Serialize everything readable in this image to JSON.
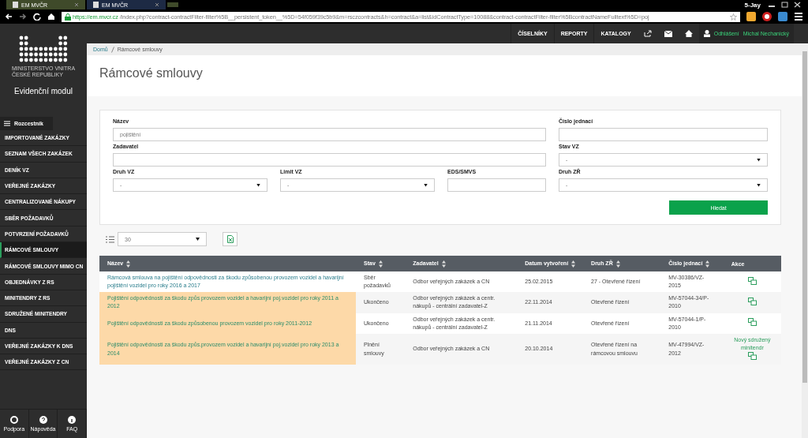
{
  "browser": {
    "tabs": [
      {
        "title": "EM MVČR",
        "selected": false
      },
      {
        "title": "EM MVČR",
        "selected": true
      }
    ],
    "user": "5-Jay",
    "url_host": "https://em.mvcr.cz",
    "url_path": "/index.php?contract-contractFilter-filter%5B__persistent_token__%5D=54f059f39c5b9&m=rsczcontracts&h=contract&a=list&idContractType=10088&contract-contractFilter-filter%5BcontractNameFulltext%5D=poj"
  },
  "header": {
    "menu": [
      "ČÍSELNÍKY",
      "REPORTY",
      "KATALOGY"
    ],
    "logout": "Odhlášení",
    "user_name": "Michal Nechanický"
  },
  "sidebar": {
    "logo_text": [
      "MINISTERSTVO VNITRA",
      "ČESKÉ REPUBLIKY"
    ],
    "app_name": "Evidenční modul",
    "menu_toggle": "Rozcestník",
    "items": [
      {
        "label": "IMPORTOVANÉ ZAKÁZKY",
        "selected": false
      },
      {
        "label": "SEZNAM VŠECH ZAKÁZEK",
        "selected": false
      },
      {
        "label": "DENÍK VZ",
        "selected": false
      },
      {
        "label": "VEŘEJNÉ ZAKÁZKY",
        "selected": false
      },
      {
        "label": "CENTRALIZOVANÉ NÁKUPY",
        "selected": false
      },
      {
        "label": "SBĚR POŽADAVKŮ",
        "selected": false
      },
      {
        "label": "POTVRZENÍ POŽADAVKŮ",
        "selected": false
      },
      {
        "label": "RÁMCOVÉ SMLOUVY",
        "selected": true
      },
      {
        "label": "RÁMCOVÉ SMLOUVY MIMO CN",
        "selected": false
      },
      {
        "label": "OBJEDNÁVKY Z RS",
        "selected": false
      },
      {
        "label": "MINITENDRY Z RS",
        "selected": false
      },
      {
        "label": "SDRUŽENÉ MINITENDRY",
        "selected": false
      },
      {
        "label": "DNS",
        "selected": false
      },
      {
        "label": "VEŘEJNÉ ZAKÁZKY K DNS",
        "selected": false
      },
      {
        "label": "VEŘEJNÉ ZAKÁZKY Z CN",
        "selected": false
      }
    ],
    "footer": [
      {
        "kind": "support",
        "label": "Podpora"
      },
      {
        "kind": "help",
        "label": "Nápověda"
      },
      {
        "kind": "info",
        "label": "FAQ"
      }
    ]
  },
  "breadcrumb": [
    "Domů",
    "Rámcové smlouvy"
  ],
  "page_title": "Rámcové smlouvy",
  "filter": {
    "nazev": {
      "label": "Název",
      "value": "pojištění"
    },
    "cislo": {
      "label": "Číslo jednací"
    },
    "zadavatel": {
      "label": "Zadavatel"
    },
    "stav": {
      "label": "Stav VZ",
      "value": "-"
    },
    "druh": {
      "label": "Druh VZ",
      "value": "-"
    },
    "limit": {
      "label": "Limit VZ",
      "value": "-"
    },
    "eds": {
      "label": "EDS/SMVS"
    },
    "druh_zr": {
      "label": "Druh ZŘ",
      "value": "-"
    },
    "search_button": "Hledat"
  },
  "page_size": "30",
  "table": {
    "columns": [
      "Název",
      "Stav",
      "Zadavatel",
      "Datum vytvoření",
      "Druh ZŘ",
      "Číslo jednací",
      "Akce"
    ],
    "rows": [
      {
        "highlighted": false,
        "name": "Rámcová smlouva na pojištění odpovědnosti za škodu způsobenou provozem vozidel a havarijní pojištění vozidel pro roky 2016 a 2017",
        "stav": "Sběr požadavků",
        "zadavatel": "Odbor veřejných zakázek a CN",
        "datum": "25.02.2015",
        "druh": "27 - Otevřené řízení",
        "cislo": "MV-30386/VZ-2015"
      },
      {
        "highlighted": true,
        "name": "Pojištění odpovědnosti za škodu způs provozem vozidel a havarijní poj.vozidel pro roky 2011 a 2012",
        "stav": "Ukončeno",
        "zadavatel": "Odbor veřejných zakázek a centr. nákupů - centrální zadavatel-Z",
        "datum": "22.11.2014",
        "druh": "Otevřené řízení",
        "cislo": "MV-57044-34/P-2010"
      },
      {
        "highlighted": true,
        "name": "Pojištění odpovědnosti za škodu způsobenou provozem vozidel pro roky 2011-2012",
        "stav": "Ukončeno",
        "zadavatel": "Odbor veřejných zakázek a centr. nákupů - centrální zadavatel-Z",
        "datum": "21.11.2014",
        "druh": "Otevřené řízení",
        "cislo": "MV-57044-1/P-2010"
      },
      {
        "highlighted": true,
        "name": "Pojištění odpovědnosti za škodu způs.provozem vozidel a havarijní poj.vozidel pro roky 2013 a 2014",
        "stav": "Plnění smlouvy",
        "zadavatel": "Odbor veřejných zakázek a CN",
        "datum": "20.10.2014",
        "druh": "Otevřené řízení na rámcovou smlouvu",
        "cislo": "MV-47994/VZ-2012",
        "action_link": "Nový sdružený minitendr"
      }
    ]
  }
}
